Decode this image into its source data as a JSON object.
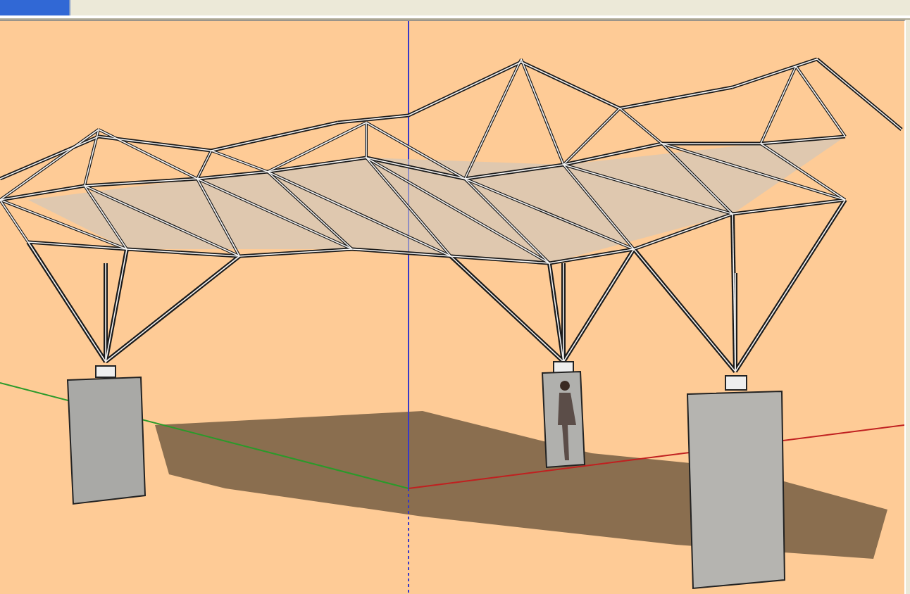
{
  "scene_tabs": [
    {
      "selected": true
    }
  ]
}
